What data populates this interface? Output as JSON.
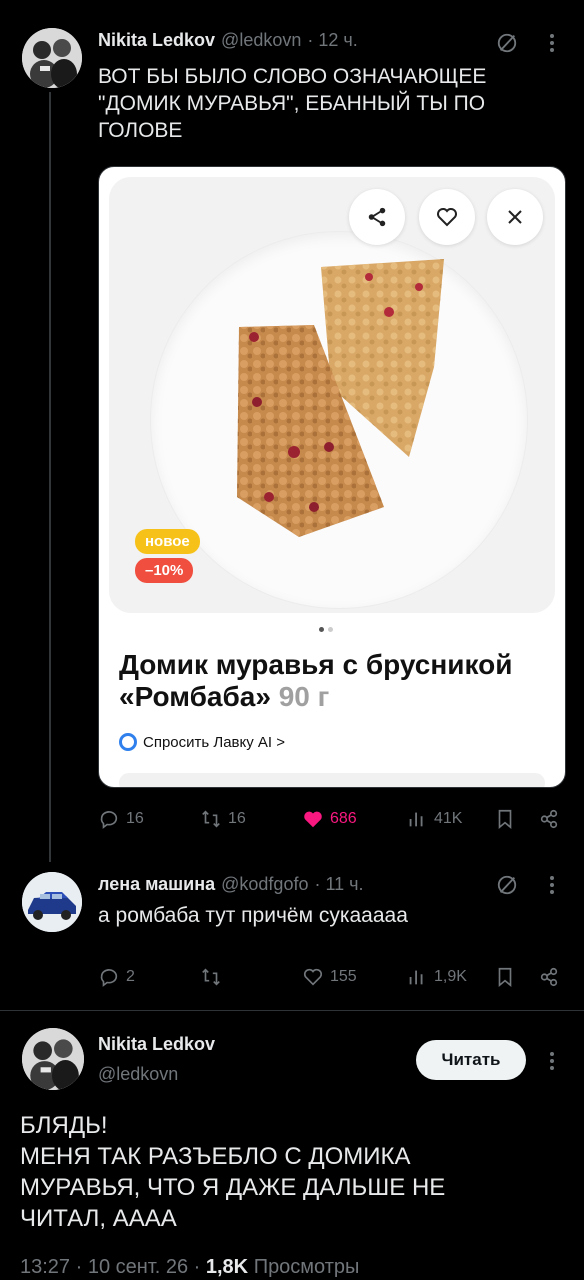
{
  "tweet1": {
    "author": "Nikita Ledkov",
    "handle": "@ledkovn",
    "time": "· 12 ч.",
    "text_lines": [
      "ВОТ БЫ БЫЛО СЛОВО ОЗНАЧАЮЩЕЕ",
      "\"ДОМИК МУРАВЬЯ\", ЕБАННЫЙ ТЫ ПО",
      "ГОЛОВЕ"
    ],
    "card": {
      "badge_new": "новое",
      "badge_discount": "–10%",
      "title": "Домик муравья с брусникой «Ромбаба»",
      "weight": "90 г",
      "ask": "Спросить Лавку AI >"
    },
    "stats": {
      "replies": "16",
      "reposts": "16",
      "likes": "686",
      "views": "41K"
    },
    "colors": {
      "like": "#f91880",
      "badge_new": "#f6c21a",
      "badge_discount": "#f04e3e"
    }
  },
  "tweet2": {
    "author": "лена машина",
    "handle": "@kodfgofo",
    "time": "· 11 ч.",
    "text": "а ромбаба тут причём сукааааа",
    "stats": {
      "replies": "2",
      "reposts": "",
      "likes": "155",
      "views": "1,9K"
    }
  },
  "tweet3": {
    "author": "Nikita Ledkov",
    "handle": "@ledkovn",
    "follow": "Читать",
    "text_lines": [
      "БЛЯДЬ!",
      "МЕНЯ ТАК РАЗЪЕБЛО С ДОМИКА",
      "МУРАВЬЯ, ЧТО Я ДАЖЕ ДАЛЬШЕ НЕ",
      "ЧИТАЛ, АААА"
    ],
    "time": "13:27 · 10 сент. 26 ·",
    "views_count": "1,8K",
    "views_label": "Просмотры"
  }
}
